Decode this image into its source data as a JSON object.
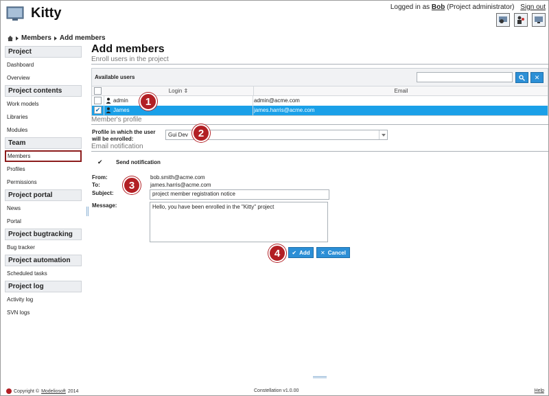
{
  "app": {
    "title": "Kitty",
    "login_prefix": "Logged in as",
    "user": "Bob",
    "role": "(Project administrator)",
    "signout": "Sign out"
  },
  "breadcrumb": [
    "Members",
    "Add members"
  ],
  "sidebar": {
    "sections": [
      {
        "title": "Project",
        "items": [
          "Dashboard",
          "Overview"
        ]
      },
      {
        "title": "Project contents",
        "items": [
          "Work models",
          "Libraries",
          "Modules"
        ]
      },
      {
        "title": "Team",
        "items": [
          "Members",
          "Profiles",
          "Permissions"
        ]
      },
      {
        "title": "Project portal",
        "items": [
          "News",
          "Portal"
        ]
      },
      {
        "title": "Project bugtracking",
        "items": [
          "Bug tracker"
        ]
      },
      {
        "title": "Project automation",
        "items": [
          "Scheduled tasks"
        ]
      },
      {
        "title": "Project log",
        "items": [
          "Activity log",
          "SVN logs"
        ]
      }
    ],
    "active_item": "Members"
  },
  "main": {
    "title": "Add members",
    "enroll_title": "Enroll users in the project",
    "available_users_label": "Available users",
    "search_value": "",
    "columns": {
      "login": "Login",
      "email": "Email"
    },
    "users": [
      {
        "login": "admin",
        "email": "admin@acme.com",
        "selected": false
      },
      {
        "login": "James",
        "email": "james.harris@acme.com",
        "selected": true
      }
    ],
    "profile_title": "Member's profile",
    "profile_label": "Profile in which the user will be enrolled:",
    "profile_label_1": "Profile in which the user",
    "profile_label_2": "will be enrolled:",
    "profile_value": "Gui Dev",
    "email_title": "Email notification",
    "send_notification_label": "Send notification",
    "send_notification_checked": true,
    "from_label": "From:",
    "from_value": "bob.smith@acme.com",
    "to_label": "To:",
    "to_value": "james.harris@acme.com",
    "subject_label": "Subject:",
    "subject_value": "project member registration notice",
    "message_label": "Message:",
    "message_value": "Hello, you have been enrolled in the \"Kitty\" project",
    "add_button": "Add",
    "cancel_button": "Cancel"
  },
  "badges": [
    "1",
    "2",
    "3",
    "4"
  ],
  "footer": {
    "copyright": "Copyright ©",
    "company": "Modeliosoft",
    "year": "2014",
    "version": "Constellation v1.0.00",
    "help": "Help"
  },
  "colors": {
    "accent": "#2c8fd6",
    "selection": "#1aa0e8",
    "badge": "#b21f24",
    "active_border": "#8b1b1b"
  }
}
